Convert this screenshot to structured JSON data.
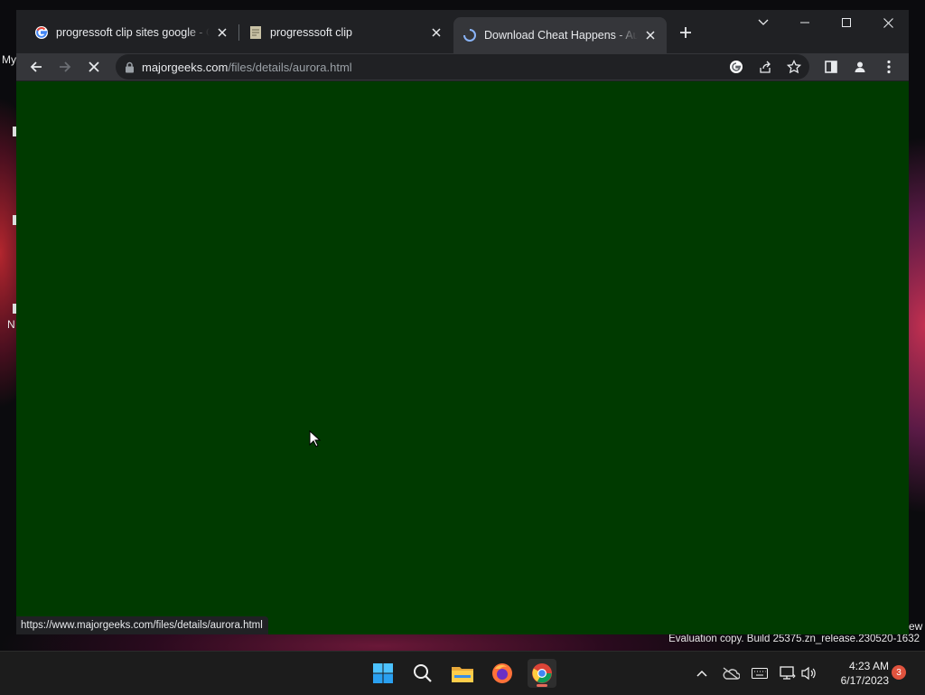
{
  "desktop": {
    "label_top": "My",
    "label_mid": "N",
    "label_right": "ew",
    "watermark": "Evaluation copy. Build 25375.zn_release.230520-1632"
  },
  "browser": {
    "tabs": [
      {
        "title": "progressoft clip sites google - Go",
        "favicon": "google-icon",
        "active": false
      },
      {
        "title": "progresssoft clip",
        "favicon": "page-icon",
        "active": false
      },
      {
        "title": "Download Cheat Happens - Aurora",
        "favicon": "loading-spinner-icon",
        "active": true
      }
    ],
    "omnibox": {
      "host": "majorgeeks.com",
      "path": "/files/details/aurora.html"
    },
    "status_url": "https://www.majorgeeks.com/files/details/aurora.html",
    "page_background": "#003a00"
  },
  "taskbar": {
    "apps": [
      "windows-start-icon",
      "search-icon",
      "file-explorer-icon",
      "firefox-icon",
      "chrome-icon"
    ],
    "time": "4:23 AM",
    "date": "6/17/2023",
    "notification_count": "3"
  },
  "colors": {
    "accent": "#8ab4f8",
    "tab_active_bg": "#35363a",
    "frame_bg": "#202124"
  }
}
